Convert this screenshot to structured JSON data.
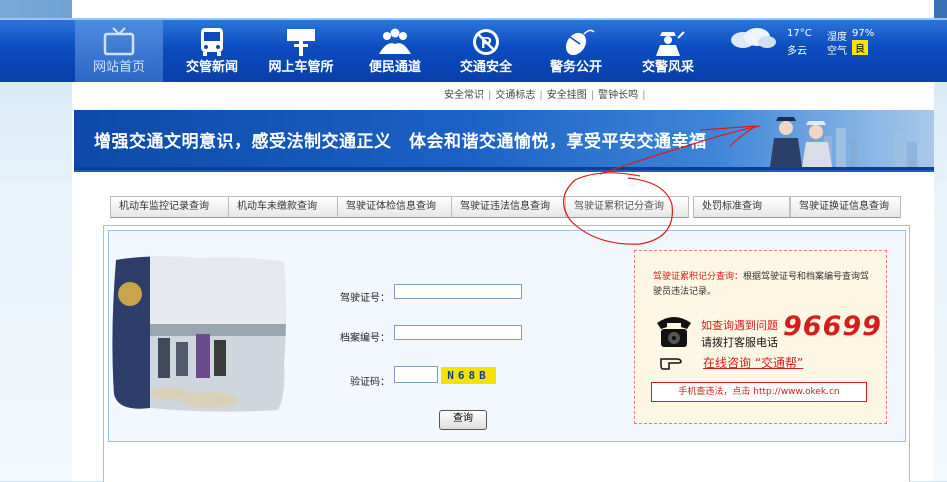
{
  "nav": {
    "items": [
      {
        "label": "网站首页",
        "icon": "tv-icon"
      },
      {
        "label": "交管新闻",
        "icon": "bus-icon"
      },
      {
        "label": "网上车管所",
        "icon": "sign-icon"
      },
      {
        "label": "便民通道",
        "icon": "people-icon"
      },
      {
        "label": "交通安全",
        "icon": "no-parking-icon"
      },
      {
        "label": "警务公开",
        "icon": "mouse-icon"
      },
      {
        "label": "交警风采",
        "icon": "officer-icon"
      }
    ]
  },
  "weather": {
    "temp": "17°C",
    "condition": "多云",
    "humidity_label": "湿度",
    "humidity": "97%",
    "air_label": "空气",
    "air_quality": "良"
  },
  "subnav": [
    "安全常识",
    "交通标志",
    "安全挂图",
    "警钟长鸣"
  ],
  "banner": {
    "slogan": "增强交通文明意识，感受法制交通正义　体会和谐交通愉悦，享受平安交通幸福"
  },
  "query_tabs": [
    "机动车监控记录查询",
    "机动车未缴款查询",
    "驾驶证体检信息查询",
    "驾驶证违法信息查询",
    "驾驶证累积记分查询",
    "处罚标准查询",
    "驾驶证换证信息查询"
  ],
  "form": {
    "license_label": "驾驶证号：",
    "license_value": "",
    "file_label": "档案编号：",
    "file_value": "",
    "captcha_label": "验证码：",
    "captcha_value": "",
    "captcha_text": "N68B",
    "submit_label": "查询"
  },
  "info": {
    "title": "驾驶证累积记分查询：",
    "desc": "根据驾驶证号和档案编号查询驾驶员违法记录。",
    "help_question": "如查询遇到问题",
    "help_call": "请拨打客服电话",
    "hotline": "96699",
    "online_link": "在线咨询 “交通帮”",
    "mobile_text": "手机查违法，点击 http://www.okek.cn"
  },
  "colors": {
    "nav_blue": "#0a4cc0",
    "accent_red": "#d61c1c",
    "air_badge": "#f3e600"
  }
}
